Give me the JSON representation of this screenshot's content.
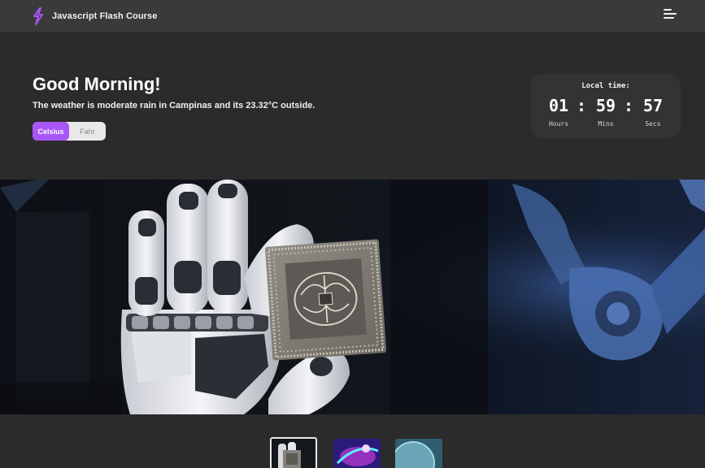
{
  "header": {
    "app_title": "Javascript Flash Course",
    "logo_icon": "lightning-bolt-icon",
    "menu_icon": "hamburger-menu-icon",
    "accent_color": "#a855f7"
  },
  "hero": {
    "greeting": "Good Morning!",
    "weather_text": "The weather is moderate rain in Campinas and its 23.32°C outside.",
    "unit_toggle": {
      "celsius_label": "Celsius",
      "fahrenheit_label": "Fahr",
      "selected": "Celsius"
    }
  },
  "clock": {
    "label": "Local time:",
    "hours": "01",
    "minutes": "59",
    "seconds": "57",
    "separator": ":",
    "hours_label": "Hours",
    "minutes_label": "Mins",
    "seconds_label": "Secs"
  },
  "gallery": {
    "thumbnails": [
      {
        "name": "robot-hand-chip",
        "active": true
      },
      {
        "name": "neon-abstract",
        "active": false
      },
      {
        "name": "planet-space",
        "active": false
      }
    ]
  }
}
